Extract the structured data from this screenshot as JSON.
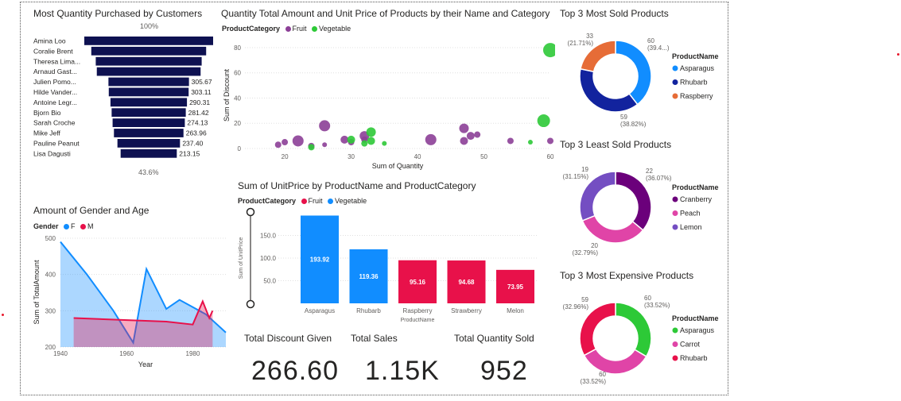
{
  "colors": {
    "navy": "#0e1151",
    "fruit": "#8c3f97",
    "vegetable": "#2dc937",
    "blue": "#118dff",
    "red": "#e8114a",
    "dark_blue": "#12239e",
    "orange": "#e66c37",
    "purple_dark": "#6b007b",
    "pink": "#e044a7",
    "violet": "#744ec2",
    "green": "#1aab40"
  },
  "funnel": {
    "title": "Most Quantity Purchased by Customers",
    "top_pct": "100%",
    "bottom_pct": "43.6%"
  },
  "scatter_title": "Quantity Total Amount and Unit Price of Products by their Name and Category",
  "scatter_legend": {
    "label": "ProductCategory",
    "fruit": "Fruit",
    "vegetable": "Vegetable"
  },
  "gender": {
    "title": "Amount of Gender and Age",
    "legend_label": "Gender",
    "f": "F",
    "m": "M"
  },
  "bar_title": "Sum of UnitPrice by ProductName and ProductCategory",
  "bar_legend": {
    "label": "ProductCategory",
    "fruit": "Fruit",
    "vegetable": "Vegetable"
  },
  "kpis": {
    "discount_label": "Total Discount Given",
    "discount_value": "266.60",
    "sales_label": "Total Sales",
    "sales_value": "1.15K",
    "qty_label": "Total Quantity Sold",
    "qty_value": "952"
  },
  "donut1": {
    "title": "Top 3 Most Sold Products",
    "legend_title": "ProductName",
    "items": [
      "Asparagus",
      "Rhubarb",
      "Raspberry"
    ]
  },
  "donut2": {
    "title": "Top 3 Least Sold Products",
    "legend_title": "ProductName",
    "items": [
      "Cranberry",
      "Peach",
      "Lemon"
    ]
  },
  "donut3": {
    "title": "Top 3 Most Expensive Products",
    "legend_title": "ProductName",
    "items": [
      "Asparagus",
      "Carrot",
      "Rhubarb"
    ]
  },
  "chart_data": [
    {
      "type": "bar",
      "orientation": "funnel",
      "title": "Most Quantity Purchased by Customers",
      "categories": [
        "Amina Loo",
        "Coralie Brent",
        "Theresa Lima...",
        "Arnaud Gast...",
        "Julien Pomo...",
        "Hilde Vander...",
        "Antoine Legr...",
        "Bjorn Bio",
        "Sarah Croche",
        "Mike Jeff",
        "Pauline Peanut",
        "Lisa Dagusti"
      ],
      "values": [
        489,
        436,
        402,
        394,
        305.67,
        303.11,
        290.31,
        281.42,
        274.13,
        263.96,
        237.4,
        213.15
      ],
      "labels": [
        "",
        "",
        "",
        "",
        "305.67",
        "303.11",
        "290.31",
        "281.42",
        "274.13",
        "263.96",
        "237.40",
        "213.15"
      ]
    },
    {
      "type": "scatter",
      "title": "Quantity Total Amount and Unit Price of Products by their Name and Category",
      "xlabel": "Sum of Quantity",
      "ylabel": "Sum of Discount",
      "xlim": [
        14,
        60
      ],
      "ylim": [
        0,
        85
      ],
      "xticks": [
        "20",
        "30",
        "40",
        "50",
        "60"
      ],
      "yticks": [
        "0",
        "20",
        "40",
        "60",
        "80"
      ],
      "series": [
        {
          "name": "Fruit",
          "points": [
            [
              19,
              3,
              4
            ],
            [
              20,
              5,
              4
            ],
            [
              22,
              6,
              7
            ],
            [
              24,
              2,
              4
            ],
            [
              26,
              18,
              7
            ],
            [
              26,
              3,
              3
            ],
            [
              29,
              7,
              5
            ],
            [
              30,
              5,
              4
            ],
            [
              32,
              10,
              6
            ],
            [
              32,
              7,
              4
            ],
            [
              42,
              7,
              7
            ],
            [
              47,
              16,
              6
            ],
            [
              47,
              6,
              5
            ],
            [
              48,
              10,
              5
            ],
            [
              49,
              11,
              4
            ],
            [
              54,
              6,
              4
            ],
            [
              60,
              6,
              4
            ]
          ]
        },
        {
          "name": "Vegetable",
          "points": [
            [
              24,
              1,
              4
            ],
            [
              30,
              7,
              5
            ],
            [
              32,
              4,
              4
            ],
            [
              33,
              13,
              6
            ],
            [
              33,
              6,
              5
            ],
            [
              35,
              4,
              3
            ],
            [
              57,
              5,
              3
            ],
            [
              59,
              22,
              8
            ],
            [
              60,
              78,
              9
            ]
          ]
        }
      ]
    },
    {
      "type": "area",
      "title": "Amount of Gender and Age",
      "xlabel": "Year",
      "ylabel": "Sum of TotalAmount",
      "xlim": [
        1940,
        1990
      ],
      "ylim": [
        200,
        500
      ],
      "xticks": [
        "1940",
        "1960",
        "1980"
      ],
      "yticks": [
        "200",
        "300",
        "400",
        "500"
      ],
      "series": [
        {
          "name": "F",
          "x": [
            1940,
            1948,
            1956,
            1962,
            1966,
            1972,
            1976,
            1980,
            1984,
            1990
          ],
          "values": [
            490,
            400,
            300,
            212,
            415,
            305,
            330,
            310,
            290,
            240
          ]
        },
        {
          "name": "M",
          "x": [
            1944,
            1972,
            1980,
            1983,
            1985,
            1986
          ],
          "values": [
            280,
            270,
            262,
            326,
            280,
            300
          ]
        }
      ]
    },
    {
      "type": "bar",
      "title": "Sum of UnitPrice by ProductName and ProductCategory",
      "xlabel": "ProductName",
      "ylabel": "Sum of UnitPrice",
      "ylim": [
        0,
        200
      ],
      "yticks": [
        "50.0",
        "100.0",
        "150.0"
      ],
      "categories": [
        "Asparagus",
        "Rhubarb",
        "Raspberry",
        "Strawberry",
        "Melon"
      ],
      "values": [
        193.92,
        119.36,
        95.16,
        94.68,
        73.95
      ],
      "labels": [
        "193.92",
        "119.36",
        "95.16",
        "94.68",
        "73.95"
      ],
      "category_type": [
        "Vegetable",
        "Vegetable",
        "Fruit",
        "Fruit",
        "Fruit"
      ]
    },
    {
      "type": "pie",
      "title": "Top 3 Most Sold Products",
      "categories": [
        "Asparagus",
        "Rhubarb",
        "Raspberry"
      ],
      "values": [
        60,
        59,
        33
      ],
      "value_labels": [
        "60",
        "59",
        "33"
      ],
      "pct_labels": [
        "(39.4...)",
        "(38.82%)",
        "(21.71%)"
      ]
    },
    {
      "type": "pie",
      "title": "Top 3 Least Sold Products",
      "categories": [
        "Cranberry",
        "Peach",
        "Lemon"
      ],
      "values": [
        22,
        20,
        19
      ],
      "value_labels": [
        "22",
        "20",
        "19"
      ],
      "pct_labels": [
        "(36.07%)",
        "(32.79%)",
        "(31.15%)"
      ]
    },
    {
      "type": "pie",
      "title": "Top 3 Most Expensive Products",
      "categories": [
        "Asparagus",
        "Carrot",
        "Rhubarb"
      ],
      "values": [
        60,
        60,
        59
      ],
      "value_labels": [
        "60",
        "60",
        "59"
      ],
      "pct_labels": [
        "(33.52%)",
        "(33.52%)",
        "(32.96%)"
      ]
    }
  ]
}
